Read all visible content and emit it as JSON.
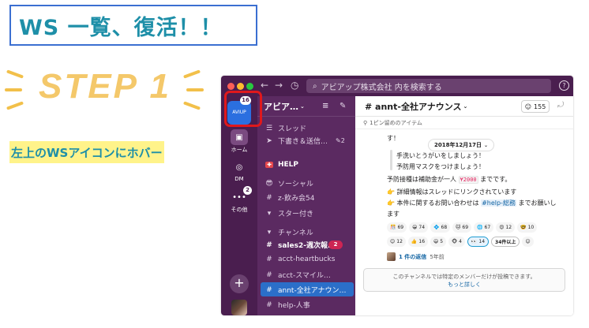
{
  "slide": {
    "title": "WS 一覧、復活！！",
    "step": "STEP 1",
    "instruction": "左上のWSアイコンにホバー"
  },
  "window": {
    "search_placeholder": "アビアップ株式会社 内を検索する",
    "help_icon": "?"
  },
  "rail": {
    "workspace_label": "AVIUP",
    "workspace_badge": "16",
    "items": [
      {
        "label": "ホーム",
        "icon": "home-icon"
      },
      {
        "label": "DM",
        "icon": "dm-icon"
      },
      {
        "label": "その他",
        "icon": "more-icon",
        "badge": "2"
      }
    ],
    "add_icon": "+"
  },
  "sidebar": {
    "workspace_name": "アビア…",
    "items": [
      {
        "icon": "thread-icon",
        "label": "スレッド"
      },
      {
        "icon": "drafts-icon",
        "label": "下書き＆送信…",
        "count": "2"
      }
    ],
    "section_help": "HELP",
    "social_label": "ソーシャル",
    "social_item": "z-飲み会54",
    "starred": "スター付き",
    "channels_header": "チャンネル",
    "channels": [
      {
        "name": "sales2-週次報…",
        "badge": "2",
        "bold": true
      },
      {
        "name": "acct-heartbucks"
      },
      {
        "name": "acct-スマイル…"
      },
      {
        "name": "annt-全社アナウン…",
        "active": true
      },
      {
        "name": "help-人事"
      }
    ]
  },
  "channel": {
    "name": "# annt-全社アナウンス",
    "member_count": "155",
    "pinned": "1ピン留めのアイテム",
    "date_divider": "2018年12月17日",
    "lines": {
      "l1": "す！",
      "l2": "手洗いとうがいをしましょう！",
      "l3": "予防用マスクをつけましょう！",
      "l4a": "予防接種は補助金が一人 ",
      "l4code": "¥2000",
      "l4b": " までです。",
      "l5": "詳細情報はスレッドにリンクされています",
      "l6a": "本件に関するお問い合わせは ",
      "l6link": "#help-総務",
      "l6b": " までお願いし",
      "l7": "ます"
    },
    "reactions_row1": [
      {
        "emoji": "🎊",
        "count": "69"
      },
      {
        "emoji": "😀",
        "count": "74"
      },
      {
        "emoji": "💠",
        "count": "68"
      },
      {
        "emoji": "🐱",
        "count": "69"
      },
      {
        "emoji": "🌐",
        "count": "67"
      },
      {
        "emoji": "😍",
        "count": "12"
      },
      {
        "emoji": "🤓",
        "count": "10"
      }
    ],
    "reactions_row2": [
      {
        "emoji": "😊",
        "count": "12"
      },
      {
        "emoji": "👍",
        "count": "16"
      },
      {
        "emoji": "😃",
        "count": "5"
      },
      {
        "emoji": "🐵",
        "count": "4"
      },
      {
        "emoji": "👀",
        "count": "14",
        "highlight": true
      },
      {
        "emoji": "",
        "count": "34件以上",
        "wide": true
      },
      {
        "emoji": "☺",
        "count": ""
      }
    ],
    "thread_reply": "1 件の返信",
    "thread_ago": "5年前",
    "compose_notice": "このチャンネルでは特定のメンバーだけが投稿できます。",
    "compose_more": "もっと詳しく"
  }
}
